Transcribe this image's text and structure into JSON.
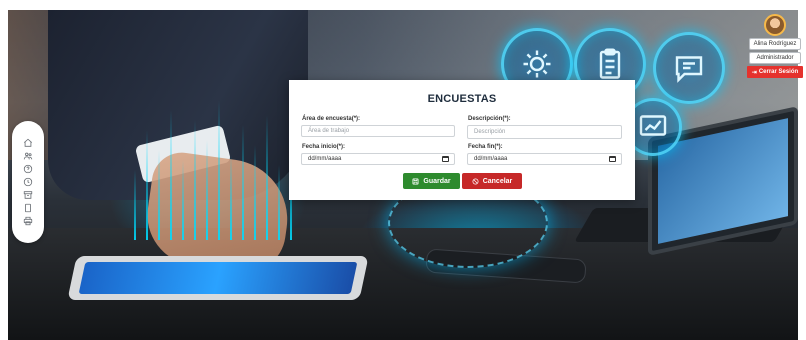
{
  "modal": {
    "title": "ENCUESTAS",
    "fields": {
      "area": {
        "label": "Área de encuesta(*):",
        "placeholder": "Área de trabajo"
      },
      "descripcion": {
        "label": "Descripción(*):",
        "placeholder": "Descripción"
      },
      "fecha_inicio": {
        "label": "Fecha inicio(*):",
        "value": "dd/mm/aaaa"
      },
      "fecha_fin": {
        "label": "Fecha fin(*):",
        "value": "dd/mm/aaaa"
      }
    },
    "buttons": {
      "save": {
        "label": "Guardar",
        "color": "#2e8b2e"
      },
      "cancel": {
        "label": "Cancelar",
        "color": "#c62828"
      }
    }
  },
  "user": {
    "name": "Alina Rodríguez",
    "role": "Administrador",
    "logout_label": "Cerrar Sesión",
    "logout_color": "#e5322d"
  },
  "sidebar": {
    "icons": [
      "home-icon",
      "users-icon",
      "help-icon",
      "clock-icon",
      "archive-icon",
      "page-icon",
      "printer-icon"
    ]
  }
}
